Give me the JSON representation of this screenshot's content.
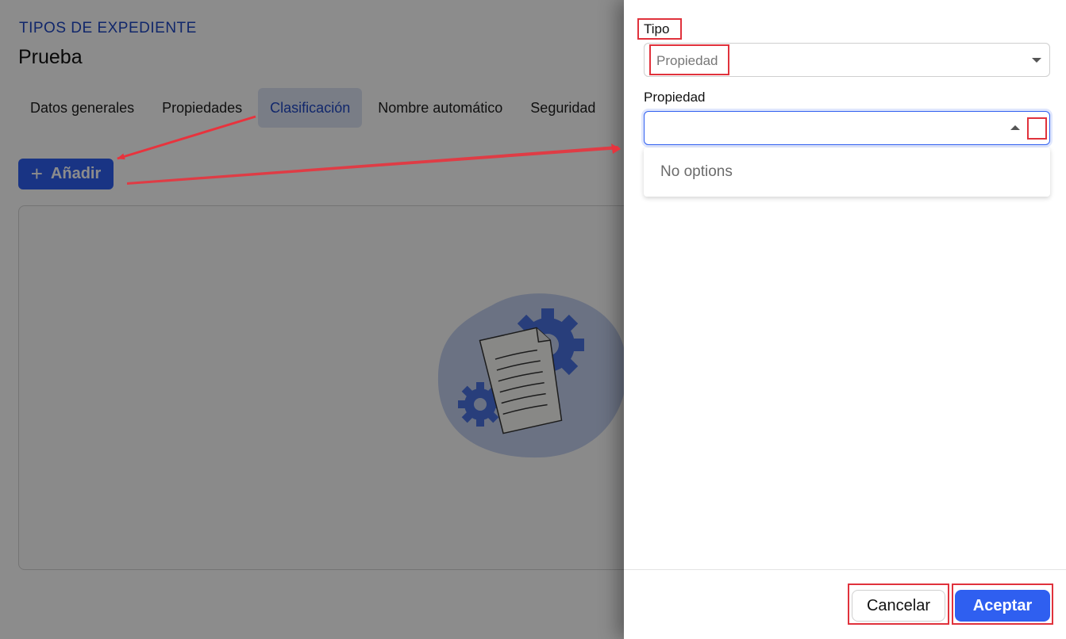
{
  "background": {
    "breadcrumb": "TIPOS DE EXPEDIENTE",
    "title": "Prueba",
    "tabs": [
      {
        "label": "Datos generales",
        "active": false
      },
      {
        "label": "Propiedades",
        "active": false
      },
      {
        "label": "Clasificación",
        "active": true
      },
      {
        "label": "Nombre automático",
        "active": false
      },
      {
        "label": "Seguridad",
        "active": false
      }
    ],
    "add_button": {
      "icon": "plus-icon",
      "label": "Añadir"
    },
    "empty_illustration": "document-with-gears-icon"
  },
  "drawer": {
    "tipo_label": "Tipo",
    "tipo_value": "Propiedad",
    "propiedad_label": "Propiedad",
    "propiedad_value": "",
    "dropdown_empty_text": "No options",
    "cancel_label": "Cancelar",
    "accept_label": "Aceptar"
  },
  "colors": {
    "accent": "#2f5ff0",
    "annotation": "#e0323c"
  }
}
